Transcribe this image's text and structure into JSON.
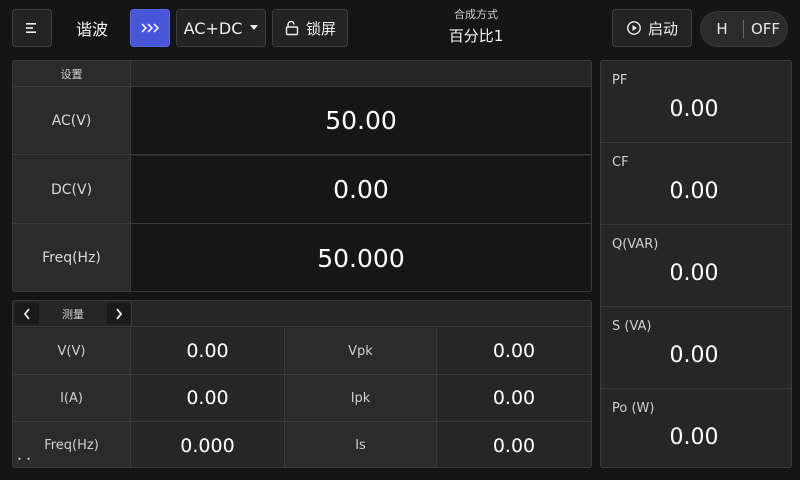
{
  "toolbar": {
    "menu_icon": "menu-icon",
    "mode_label": "谐波",
    "forward_icon": "triple-chevron-right-icon",
    "accent_color": "#4a56d8",
    "acdc_label": "AC+DC",
    "acdc_icon": "caret-down-icon",
    "lock_label": "锁屏",
    "lock_icon": "unlock-icon",
    "compose_caption": "合成方式",
    "compose_value": "百分比1",
    "start_label": "启动",
    "start_icon": "play-circle-icon",
    "range_label": "H",
    "output_label": "OFF"
  },
  "settings": {
    "header": "设置",
    "rows": [
      {
        "label": "AC(V)",
        "value": "50.00"
      },
      {
        "label": "DC(V)",
        "value": "0.00"
      },
      {
        "label": "Freq(Hz)",
        "value": "50.000"
      }
    ]
  },
  "measure": {
    "header": "测量",
    "prev_icon": "chevron-left-icon",
    "next_icon": "chevron-right-icon",
    "rows": [
      {
        "label1": "V(V)",
        "value1": "0.00",
        "label2": "Vpk",
        "value2": "0.00"
      },
      {
        "label1": "I(A)",
        "value1": "0.00",
        "label2": "Ipk",
        "value2": "0.00"
      },
      {
        "label1": "Freq(Hz)",
        "value1": "0.000",
        "label2": "Is",
        "value2": "0.00"
      }
    ],
    "page_dots": "• •"
  },
  "side": {
    "items": [
      {
        "label": "PF",
        "value": "0.00"
      },
      {
        "label": "CF",
        "value": "0.00"
      },
      {
        "label": "Q(VAR)",
        "value": "0.00"
      },
      {
        "label": "S (VA)",
        "value": "0.00"
      },
      {
        "label": "Po (W)",
        "value": "0.00"
      }
    ]
  }
}
